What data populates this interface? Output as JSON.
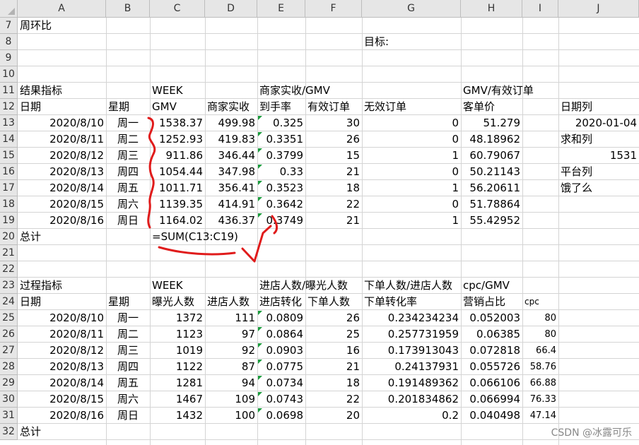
{
  "columns": [
    "A",
    "B",
    "C",
    "D",
    "E",
    "F",
    "G",
    "H",
    "I",
    "J"
  ],
  "rows": [
    {
      "n": "7",
      "cells": {
        "A": "周环比"
      }
    },
    {
      "n": "8",
      "cells": {
        "G": "目标:"
      }
    },
    {
      "n": "9",
      "cells": {}
    },
    {
      "n": "10",
      "cells": {}
    },
    {
      "n": "11",
      "cells": {
        "A": "结果指标",
        "C": "WEEK",
        "E": "商家实收/GMV",
        "H": "GMV/有效订单"
      }
    },
    {
      "n": "12",
      "cells": {
        "A": "日期",
        "B": "星期",
        "C": "GMV",
        "D": "商家实收",
        "E": "到手率",
        "F": "有效订单",
        "G": "无效订单",
        "H": "客单价",
        "J": "日期列"
      }
    },
    {
      "n": "13",
      "cells": {
        "A": "2020/8/10",
        "B": "周一",
        "C": "1538.37",
        "D": "499.98",
        "E": "0.325",
        "F": "30",
        "G": "0",
        "H": "51.279",
        "J": "2020-01-04"
      }
    },
    {
      "n": "14",
      "cells": {
        "A": "2020/8/11",
        "B": "周二",
        "C": "1252.93",
        "D": "419.83",
        "E": "0.3351",
        "F": "26",
        "G": "0",
        "H": "48.18962",
        "J": "求和列"
      }
    },
    {
      "n": "15",
      "cells": {
        "A": "2020/8/12",
        "B": "周三",
        "C": "911.86",
        "D": "346.44",
        "E": "0.3799",
        "F": "15",
        "G": "1",
        "H": "60.79067",
        "J": "1531"
      }
    },
    {
      "n": "16",
      "cells": {
        "A": "2020/8/13",
        "B": "周四",
        "C": "1054.44",
        "D": "347.98",
        "E": "0.33",
        "F": "21",
        "G": "0",
        "H": "50.21143",
        "J": "平台列"
      }
    },
    {
      "n": "17",
      "cells": {
        "A": "2020/8/14",
        "B": "周五",
        "C": "1011.71",
        "D": "356.41",
        "E": "0.3523",
        "F": "18",
        "G": "1",
        "H": "56.20611",
        "J": "饿了么"
      }
    },
    {
      "n": "18",
      "cells": {
        "A": "2020/8/15",
        "B": "周六",
        "C": "1139.35",
        "D": "414.91",
        "E": "0.3642",
        "F": "22",
        "G": "0",
        "H": "51.78864"
      }
    },
    {
      "n": "19",
      "cells": {
        "A": "2020/8/16",
        "B": "周日",
        "C": "1164.02",
        "D": "436.37",
        "E": "0.3749",
        "F": "21",
        "G": "1",
        "H": "55.42952"
      }
    },
    {
      "n": "20",
      "cells": {
        "A": "总计",
        "C": "=SUM(C13:C19)"
      }
    },
    {
      "n": "21",
      "cells": {}
    },
    {
      "n": "22",
      "cells": {}
    },
    {
      "n": "23",
      "cells": {
        "A": "过程指标",
        "C": "WEEK",
        "E": "进店人数/曝光人数",
        "G": "下单人数/进店人数",
        "H": "cpc/GMV"
      }
    },
    {
      "n": "24",
      "cells": {
        "A": "日期",
        "B": "星期",
        "C": "曝光人数",
        "D": "进店人数",
        "E": "进店转化",
        "F": "下单人数",
        "G": "下单转化率",
        "H": "营销占比",
        "I": "cpc"
      }
    },
    {
      "n": "25",
      "cells": {
        "A": "2020/8/10",
        "B": "周一",
        "C": "1372",
        "D": "111",
        "E": "0.0809",
        "F": "26",
        "G": "0.234234234",
        "H": "0.052003",
        "I": "80"
      }
    },
    {
      "n": "26",
      "cells": {
        "A": "2020/8/11",
        "B": "周二",
        "C": "1123",
        "D": "97",
        "E": "0.0864",
        "F": "25",
        "G": "0.257731959",
        "H": "0.06385",
        "I": "80"
      }
    },
    {
      "n": "27",
      "cells": {
        "A": "2020/8/12",
        "B": "周三",
        "C": "1019",
        "D": "92",
        "E": "0.0903",
        "F": "16",
        "G": "0.173913043",
        "H": "0.072818",
        "I": "66.4"
      }
    },
    {
      "n": "28",
      "cells": {
        "A": "2020/8/13",
        "B": "周四",
        "C": "1122",
        "D": "87",
        "E": "0.0775",
        "F": "21",
        "G": "0.24137931",
        "H": "0.055726",
        "I": "58.76"
      }
    },
    {
      "n": "29",
      "cells": {
        "A": "2020/8/14",
        "B": "周五",
        "C": "1281",
        "D": "94",
        "E": "0.0734",
        "F": "18",
        "G": "0.191489362",
        "H": "0.066106",
        "I": "66.88"
      }
    },
    {
      "n": "30",
      "cells": {
        "A": "2020/8/15",
        "B": "周六",
        "C": "1467",
        "D": "109",
        "E": "0.0743",
        "F": "22",
        "G": "0.201834862",
        "H": "0.066994",
        "I": "76.33"
      }
    },
    {
      "n": "31",
      "cells": {
        "A": "2020/8/16",
        "B": "周日",
        "C": "1432",
        "D": "100",
        "E": "0.0698",
        "F": "20",
        "G": "0.2",
        "H": "0.040498",
        "I": "47.14"
      }
    },
    {
      "n": "32",
      "cells": {
        "A": "总计"
      }
    }
  ],
  "watermark": "CSDN @冰露可乐"
}
